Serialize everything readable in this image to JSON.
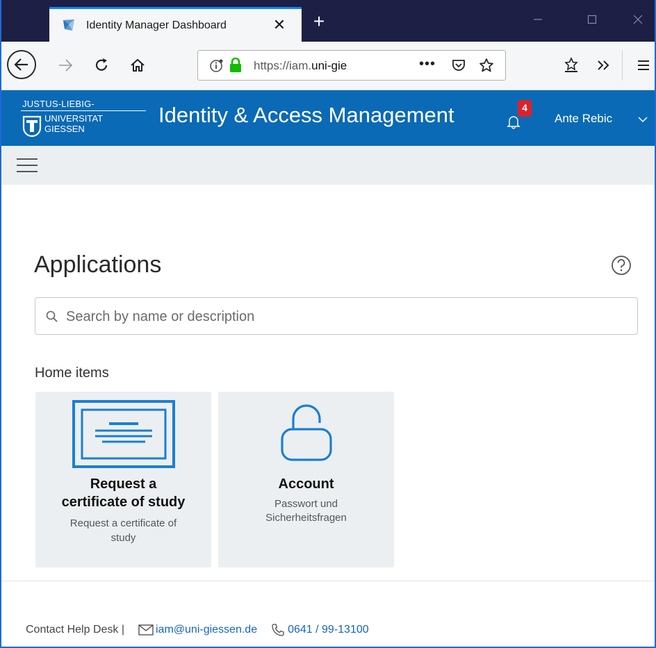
{
  "browser": {
    "tab_title": "Identity Manager Dashboard",
    "tab_close": "✕",
    "new_tab": "+",
    "url_prefix": "https://iam.",
    "url_domain": "uni-gie",
    "url_more": "•••"
  },
  "header": {
    "uni_line1": "JUSTUS-LIEBIG-",
    "uni_line2": "UNIVERSITAT",
    "uni_line3": "GIESSEN",
    "title": "Identity & Access Management",
    "notification_count": "4",
    "user_name": "Ante Rebic"
  },
  "main": {
    "title": "Applications",
    "search_placeholder": "Search by name or description",
    "section_title": "Home items",
    "tiles": [
      {
        "name_line1": "Request a",
        "name_line2": "certificate of study",
        "desc_line1": "Request a certificate of",
        "desc_line2": "study"
      },
      {
        "name_line1": "Account",
        "desc_line1": "Passwort und",
        "desc_line2": "Sicherheitsfragen"
      }
    ]
  },
  "footer": {
    "contact_label": "Contact Help Desk |",
    "email": "iam@uni-giessen.de",
    "phone": "0641 / 99-13100"
  },
  "colors": {
    "accent": "#0a6ab5",
    "titlebar": "#1e1f45",
    "badge": "#d9232e",
    "link": "#1565c0",
    "tile_icon": "#1a7fd4"
  }
}
